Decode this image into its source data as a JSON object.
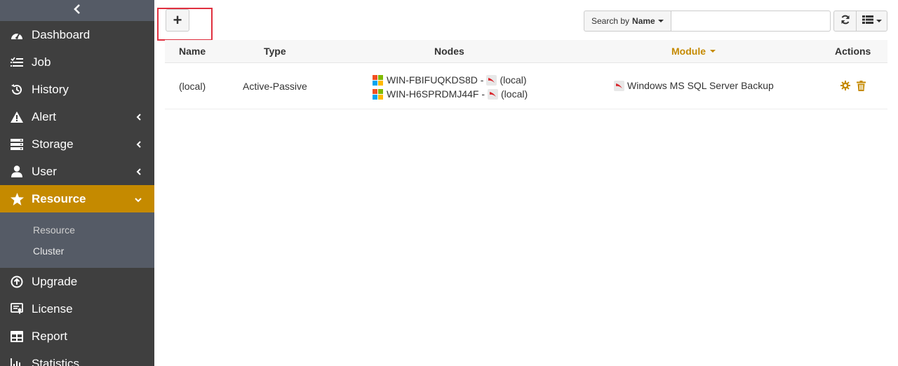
{
  "sidebar": {
    "collapse_icon": "chevron-left-icon",
    "items": [
      {
        "label": "Dashboard",
        "icon": "gauge-icon"
      },
      {
        "label": "Job",
        "icon": "tasks-icon"
      },
      {
        "label": "History",
        "icon": "history-icon"
      },
      {
        "label": "Alert",
        "icon": "warning-icon",
        "has_children": true
      },
      {
        "label": "Storage",
        "icon": "server-icon",
        "has_children": true
      },
      {
        "label": "User",
        "icon": "user-icon",
        "has_children": true
      },
      {
        "label": "Resource",
        "icon": "star-icon",
        "active": true,
        "expanded": true
      }
    ],
    "submenu": [
      {
        "label": "Resource",
        "current": true
      },
      {
        "label": "Cluster"
      }
    ],
    "items_after": [
      {
        "label": "Upgrade",
        "icon": "arrow-up-circle-icon"
      },
      {
        "label": "License",
        "icon": "certificate-icon"
      },
      {
        "label": "Report",
        "icon": "table-icon"
      },
      {
        "label": "Statistics",
        "icon": "bar-chart-icon"
      }
    ]
  },
  "toolbar": {
    "add_label": "+",
    "search_by_prefix": "Search by",
    "search_by_field": "Name",
    "search_value": "",
    "refresh_icon": "refresh-icon",
    "columns_icon": "list-icon"
  },
  "table": {
    "headers": {
      "name": "Name",
      "type": "Type",
      "nodes": "Nodes",
      "module": "Module",
      "actions": "Actions"
    },
    "sorted_column": "module",
    "rows": [
      {
        "name": "(local)",
        "type": "Active-Passive",
        "nodes": [
          {
            "host": "WIN-FBIFUQKDS8D -",
            "target": "(local)"
          },
          {
            "host": "WIN-H6SPRDMJ44F -",
            "target": "(local)"
          }
        ],
        "module": "Windows MS SQL Server Backup"
      }
    ]
  },
  "colors": {
    "sidebar_bg": "#3f3f3f",
    "sidebar_sub_bg": "#555b66",
    "accent": "#c58a00",
    "highlight": "#e0303f"
  }
}
